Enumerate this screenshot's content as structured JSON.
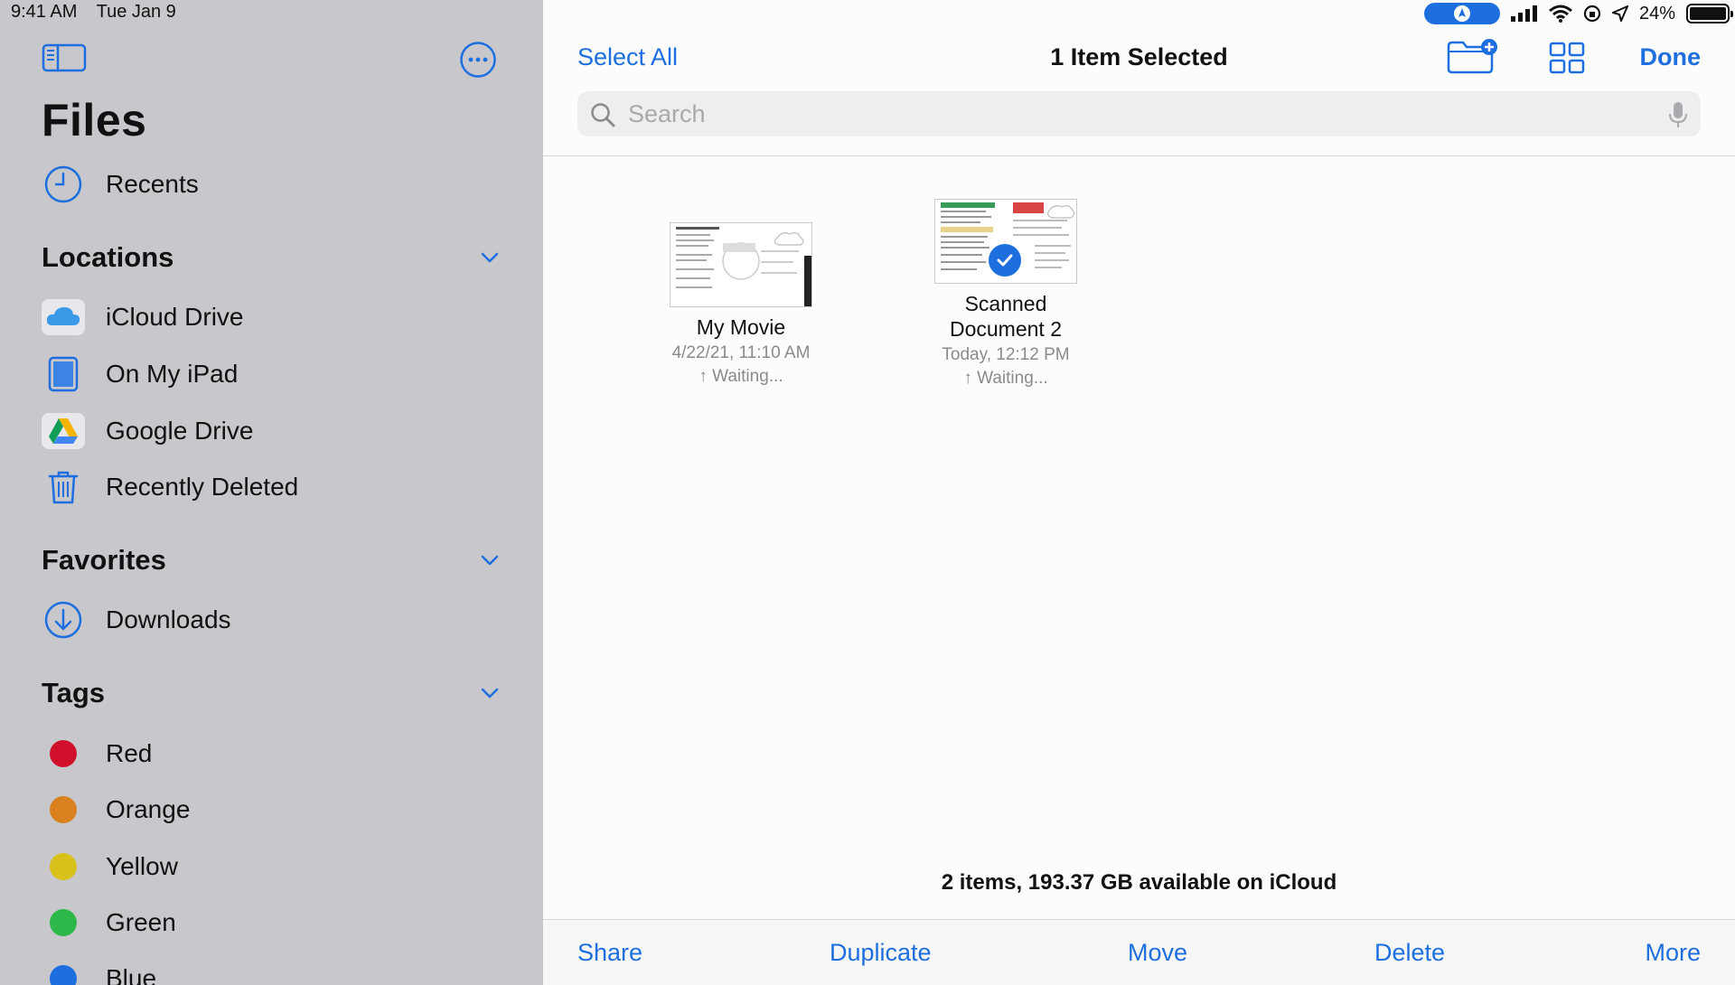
{
  "status_bar": {
    "time": "9:41 AM",
    "date": "Tue Jan 9",
    "battery": "24%"
  },
  "sidebar": {
    "title": "Files",
    "recents_label": "Recents",
    "locations": {
      "heading": "Locations",
      "items": [
        {
          "label": "iCloud Drive",
          "icon": "icloud-icon"
        },
        {
          "label": "On My iPad",
          "icon": "ipad-icon"
        },
        {
          "label": "Google Drive",
          "icon": "google-drive-icon"
        },
        {
          "label": "Recently Deleted",
          "icon": "trash-icon"
        }
      ]
    },
    "favorites": {
      "heading": "Favorites",
      "items": [
        {
          "label": "Downloads",
          "icon": "download-icon"
        }
      ]
    },
    "tags": {
      "heading": "Tags",
      "items": [
        {
          "label": "Red",
          "color": "#d0102a"
        },
        {
          "label": "Orange",
          "color": "#d9811f"
        },
        {
          "label": "Yellow",
          "color": "#d8c11a"
        },
        {
          "label": "Green",
          "color": "#2fb84a"
        },
        {
          "label": "Blue",
          "color": "#1d6fe0"
        }
      ]
    }
  },
  "nav": {
    "select_all": "Select All",
    "title": "1 Item Selected",
    "done": "Done"
  },
  "search": {
    "placeholder": "Search"
  },
  "files": [
    {
      "name": "My Movie",
      "date": "4/22/21, 11:10 AM",
      "status": "↑ Waiting...",
      "selected": false
    },
    {
      "name": "Scanned Document 2",
      "date": "Today, 12:12 PM",
      "status": "↑ Waiting...",
      "selected": true
    }
  ],
  "footer": {
    "info": "2 items, 193.37 GB available on iCloud"
  },
  "toolbar": {
    "share": "Share",
    "duplicate": "Duplicate",
    "move": "Move",
    "delete": "Delete",
    "more": "More"
  },
  "colors": {
    "accent": "#1d6fe0",
    "sidebar_bg": "#c8c7cc"
  }
}
